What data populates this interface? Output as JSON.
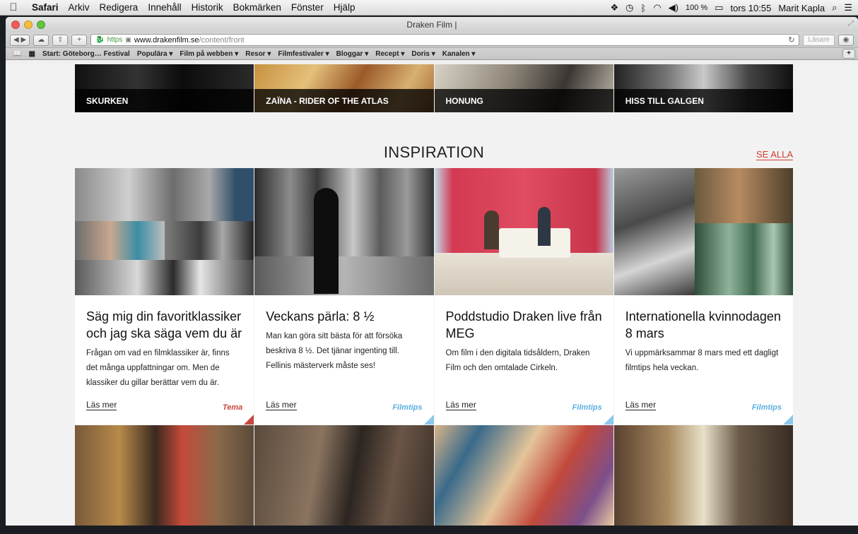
{
  "menubar": {
    "app": "Safari",
    "items": [
      "Arkiv",
      "Redigera",
      "Innehåll",
      "Historik",
      "Bokmärken",
      "Fönster",
      "Hjälp"
    ],
    "battery": "100 %",
    "clock": "tors 10:55",
    "user": "Marit Kapla"
  },
  "window": {
    "title": "Draken Film |",
    "url_scheme": "https",
    "url_domain": "www.drakenfilm.se",
    "url_path": "/content/front",
    "reader_label": "Läsare"
  },
  "bookmarks": [
    "Start: Göteborg… Festival",
    "Populära ▾",
    "Film på webben ▾",
    "Resor ▾",
    "Filmfestivaler ▾",
    "Bloggar ▾",
    "Recept ▾",
    "Doris ▾",
    "Kanalen ▾"
  ],
  "films": [
    {
      "title": "SKURKEN"
    },
    {
      "title": "ZAÏNA - RIDER OF THE ATLAS"
    },
    {
      "title": "HONUNG"
    },
    {
      "title": "HISS TILL GALGEN"
    }
  ],
  "inspiration": {
    "heading": "INSPIRATION",
    "see_all": "SE ALLA",
    "cards": [
      {
        "title": "Säg mig din favoritklassiker och jag ska säga vem du är",
        "text": "Frågan om vad en filmklassiker är, finns det många uppfattningar om. Men de klassiker du gillar berättar vem du är.",
        "more": "Läs mer",
        "category": "Tema"
      },
      {
        "title": "Veckans pärla: 8 ½",
        "text": "Man kan göra sitt bästa för att försöka beskriva 8 ½. Det tjänar ingenting till. Fellinis mästerverk måste ses!",
        "more": "Läs mer",
        "category": "Filmtips"
      },
      {
        "title": "Poddstudio Draken live från MEG",
        "text": "Om film i den digitala tidsåldern, Draken Film och den omtalade Cirkeln.",
        "more": "Läs mer",
        "category": "Filmtips"
      },
      {
        "title": "Internationella kvinnodagen 8 mars",
        "text": "Vi uppmärksammar 8 mars med ett dagligt filmtips hela veckan.",
        "more": "Läs mer",
        "category": "Filmtips"
      }
    ]
  }
}
